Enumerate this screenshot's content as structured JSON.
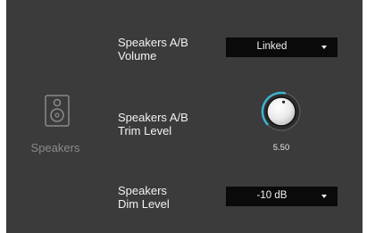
{
  "sidebar": {
    "icon": "speaker-icon",
    "label": "Speakers"
  },
  "settings": {
    "volume": {
      "label_line1": "Speakers A/B",
      "label_line2": "Volume",
      "selected": "Linked"
    },
    "trim": {
      "label_line1": "Speakers A/B",
      "label_line2": "Trim Level",
      "value": "5.50",
      "knob_fraction": 0.55
    },
    "dim": {
      "label_line1": "Speakers",
      "label_line2": "Dim Level",
      "selected": "-10 dB"
    }
  },
  "colors": {
    "panel": "#3b3b3b",
    "dropdown_bg": "#0a0a0a",
    "accent": "#3fb4d2",
    "muted_text": "#8a8a8a"
  }
}
